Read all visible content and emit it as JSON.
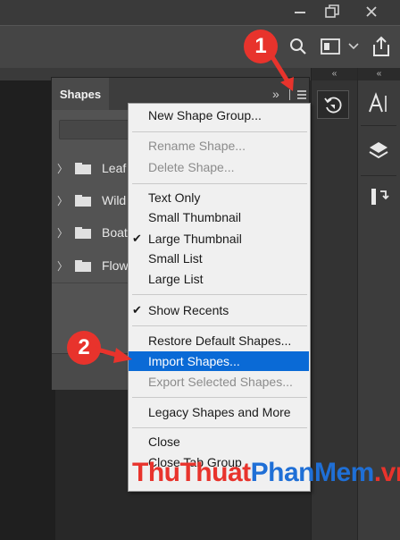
{
  "window": {
    "minimize_icon": "minimize-icon",
    "restore_icon": "restore-icon",
    "close_icon": "close-icon"
  },
  "options_bar": {
    "icons": [
      "search-icon",
      "workspace-icon",
      "chevron-down-icon",
      "share-icon"
    ]
  },
  "right_strip": {
    "collapse_glyph": "«",
    "tools": [
      "history-icon",
      "character-icon",
      "layers-icon",
      "adjustments-icon"
    ]
  },
  "shapes_panel": {
    "tab_label": "Shapes",
    "expand_glyph": "»",
    "menu_icon": "hamburger-menu-icon",
    "groups": [
      {
        "label": "Leaf"
      },
      {
        "label": "Wild"
      },
      {
        "label": "Boat"
      },
      {
        "label": "Flow"
      }
    ]
  },
  "menu": {
    "items": [
      {
        "label": "New Shape Group...",
        "disabled": false
      },
      {
        "label": "Rename Shape...",
        "disabled": true
      },
      {
        "label": "Delete Shape...",
        "disabled": true
      },
      {
        "label": "Text Only",
        "disabled": false
      },
      {
        "label": "Small Thumbnail",
        "disabled": false
      },
      {
        "label": "Large Thumbnail",
        "disabled": false,
        "checked": true
      },
      {
        "label": "Small List",
        "disabled": false
      },
      {
        "label": "Large List",
        "disabled": false
      },
      {
        "label": "Show Recents",
        "disabled": false,
        "checked": true
      },
      {
        "label": "Restore Default Shapes...",
        "disabled": false
      },
      {
        "label": "Import Shapes...",
        "disabled": false,
        "highlighted": true
      },
      {
        "label": "Export Selected Shapes...",
        "disabled": true
      },
      {
        "label": "Legacy Shapes and More",
        "disabled": false
      },
      {
        "label": "Close",
        "disabled": false
      },
      {
        "label": "Close Tab Group",
        "disabled": false
      }
    ],
    "check_glyph": "✔"
  },
  "annotations": {
    "step1": "1",
    "step2": "2",
    "color": "#e8332c"
  },
  "watermark": {
    "part1": "ThuThuat",
    "part2": "PhanMem",
    "part3": ".vn"
  },
  "colors": {
    "highlight": "#0a6ad6",
    "panel": "#535353",
    "menu_bg": "#f0f0f0"
  }
}
